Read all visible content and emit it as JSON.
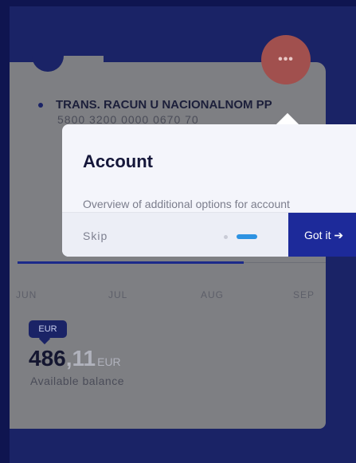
{
  "account": {
    "name": "TRANS. RACUN U NACIONALNOM PP",
    "number": "5800 3200 0000 0670 70"
  },
  "more_button": {
    "label": "•••"
  },
  "popover": {
    "title": "Account",
    "description": "Overview of additional options for account",
    "skip_label": "Skip",
    "got_it_label": "Got it ➔",
    "step_current": 2,
    "step_total": 2
  },
  "chart": {
    "months": [
      "JUN",
      "JUL",
      "AUG",
      "SEP"
    ]
  },
  "balance": {
    "currency_badge": "EUR",
    "integer": "486",
    "decimal": ",11",
    "currency": "EUR",
    "label": "Available balance"
  },
  "colors": {
    "accent": "#1d2a9a",
    "indicator": "#2d92e2",
    "more_button": "#a1504e"
  }
}
